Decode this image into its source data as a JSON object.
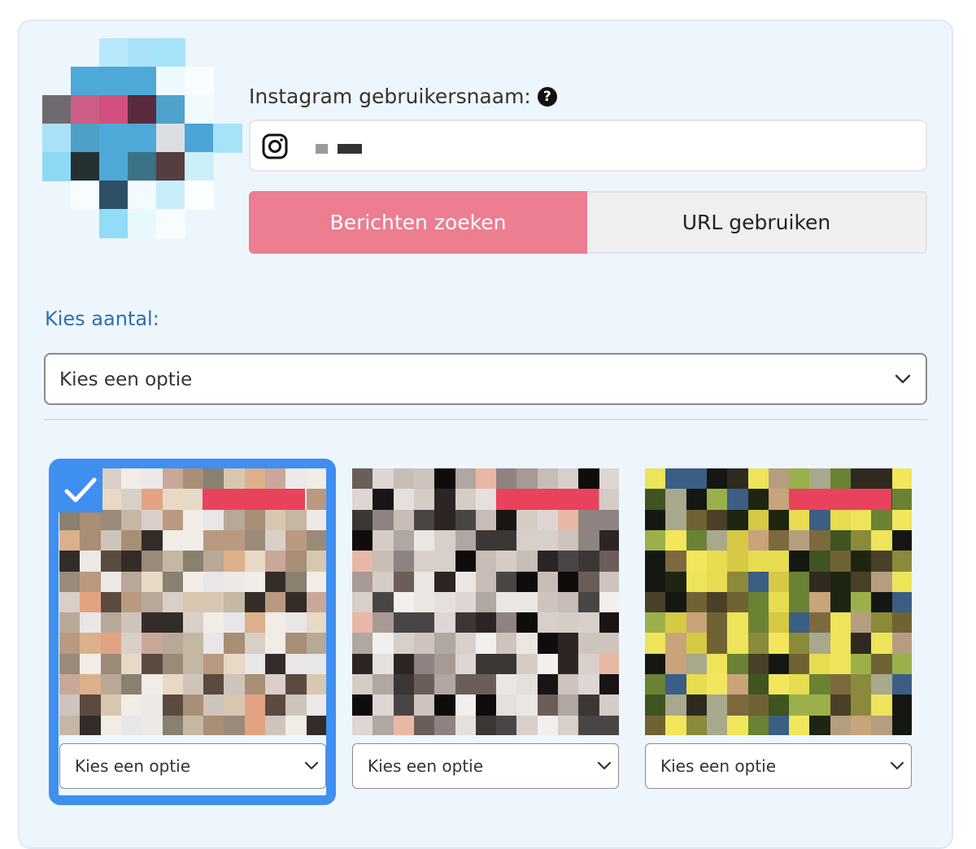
{
  "form": {
    "username_label": "Instagram gebruikersnaam:",
    "help_icon": "question-circle-icon",
    "instagram_icon": "instagram-icon",
    "username_value_redacted": true
  },
  "mode_toggle": {
    "options": [
      {
        "label": "Berichten zoeken",
        "active": true
      },
      {
        "label": "URL gebruiken",
        "active": false
      }
    ],
    "active_color": "#ed7d90"
  },
  "count": {
    "label": "Kies aantal:",
    "selected_value": "Kies een optie",
    "chevron_icon": "chevron-down-icon"
  },
  "posts": [
    {
      "selected": true,
      "option_value": "Kies een optie"
    },
    {
      "selected": false,
      "option_value": "Kies een optie"
    },
    {
      "selected": false,
      "option_value": "Kies een optie"
    }
  ],
  "colors": {
    "card_background": "#eef6fd",
    "accent_blue": "#3f8ff0",
    "label_blue": "#2f6fb0",
    "badge_red": "#e9425c"
  }
}
